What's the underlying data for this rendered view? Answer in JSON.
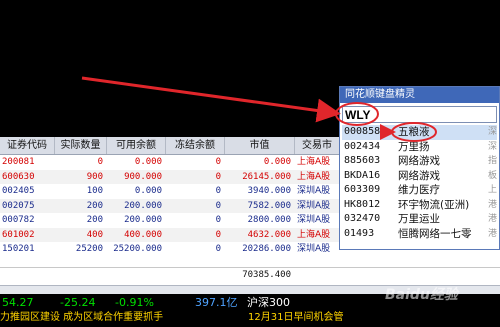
{
  "holdings": {
    "columns": [
      "证券代码",
      "实际数量",
      "可用余额",
      "冻结余额",
      "市值",
      "交易市"
    ],
    "rows": [
      {
        "code": "200081",
        "qty": "0",
        "avail": "0.000",
        "frozen": "0",
        "value": "0.000",
        "market": "上海A股",
        "color": "red"
      },
      {
        "code": "600630",
        "qty": "900",
        "avail": "900.000",
        "frozen": "0",
        "value": "26145.000",
        "market": "上海A股",
        "color": "red"
      },
      {
        "code": "002405",
        "qty": "100",
        "avail": "0.000",
        "frozen": "0",
        "value": "3940.000",
        "market": "深圳A股",
        "color": "blue"
      },
      {
        "code": "002075",
        "qty": "200",
        "avail": "200.000",
        "frozen": "0",
        "value": "7582.000",
        "market": "深圳A股",
        "color": "blue"
      },
      {
        "code": "000782",
        "qty": "200",
        "avail": "200.000",
        "frozen": "0",
        "value": "2800.000",
        "market": "深圳A股",
        "color": "blue"
      },
      {
        "code": "601002",
        "qty": "400",
        "avail": "400.000",
        "frozen": "0",
        "value": "4632.000",
        "market": "上海A股",
        "color": "red"
      },
      {
        "code": "150201",
        "qty": "25200",
        "avail": "25200.000",
        "frozen": "0",
        "value": "20286.000",
        "market": "深圳A股",
        "color": "blue"
      }
    ],
    "total_value": "70385.400"
  },
  "ticker": {
    "items": [
      {
        "text": "54.27",
        "color": "#00e000"
      },
      {
        "text": "-25.24",
        "color": "#00e000"
      },
      {
        "text": "-0.91%",
        "color": "#00e000"
      },
      {
        "text": "397.1亿",
        "color": "#4fa3ff"
      },
      {
        "text": "沪深300",
        "color": "#ffffff"
      }
    ],
    "news_left": "力推园区建设 成为区域合作重要抓手",
    "news_right": "12月31日早间机会管"
  },
  "wizard": {
    "title": "同花顺键盘精灵",
    "input_value": "WLY",
    "suggestions": [
      {
        "code": "000858",
        "name": "五粮液",
        "market": "深"
      },
      {
        "code": "002434",
        "name": "万里扬",
        "market": "深"
      },
      {
        "code": "885603",
        "name": "网络游戏",
        "market": "指"
      },
      {
        "code": "BKDA16",
        "name": "网络游戏",
        "market": "板"
      },
      {
        "code": "603309",
        "name": "维力医疗",
        "market": "上"
      },
      {
        "code": "HK8012",
        "name": "环宇物流(亚洲)",
        "market": "港"
      },
      {
        "code": "032470",
        "name": "万里运业",
        "market": "港"
      },
      {
        "code": "01493",
        "name": "恒腾网络一七零",
        "market": "港"
      }
    ],
    "selected_index": 0
  },
  "watermark": "Baidu经验",
  "colors": {
    "annotation": "#e0262b",
    "title_bar": "#3f68b8",
    "selected_row": "#cfe0f5"
  }
}
